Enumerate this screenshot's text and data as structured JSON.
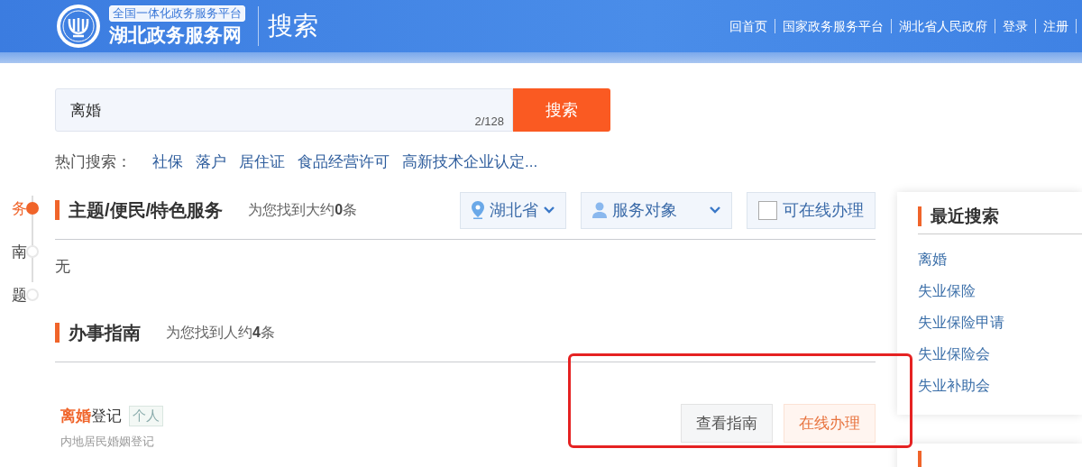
{
  "header": {
    "platform_badge": "全国一体化政务服务平台",
    "site_name": "湖北政务服务网",
    "page_title": "搜索",
    "links": [
      "回首页",
      "国家政务服务平台",
      "湖北省人民政府",
      "登录",
      "注册"
    ]
  },
  "search": {
    "value": "离婚",
    "counter": "2/128",
    "button": "搜索"
  },
  "hot_searches": {
    "label": "热门搜索：",
    "items": [
      "社保",
      "落户",
      "居住证",
      "食品经营许可",
      "高新技术企业认定..."
    ]
  },
  "timeline": [
    {
      "label": "务",
      "selected": true
    },
    {
      "label": "南",
      "selected": false
    },
    {
      "label": "题",
      "selected": false
    }
  ],
  "sections": [
    {
      "title": "主题/便民/特色服务",
      "summary": "为您找到大约**0**条",
      "filters": [
        {
          "kind": "region",
          "label": "湖北省"
        },
        {
          "kind": "audience",
          "label": "服务对象"
        },
        {
          "kind": "checkbox",
          "label": "可在线办理",
          "checked": false
        }
      ],
      "empty_text": "无"
    },
    {
      "title": "办事指南",
      "summary": "为您找到人约**4**条",
      "items": [
        {
          "title": "**离婚**登记",
          "tag": "个人",
          "subtitle": "内地居民婚姻登记",
          "buttons": [
            {
              "label": "查看指南",
              "kind": "plain"
            },
            {
              "label": "在线办理",
              "kind": "accent"
            }
          ]
        }
      ]
    }
  ],
  "recent_searches": {
    "title": "最近搜索",
    "items": [
      "离婚",
      "失业保险",
      "失业保险甲请",
      "失业保险会",
      "失业补助会"
    ]
  },
  "annotation_box": true
}
